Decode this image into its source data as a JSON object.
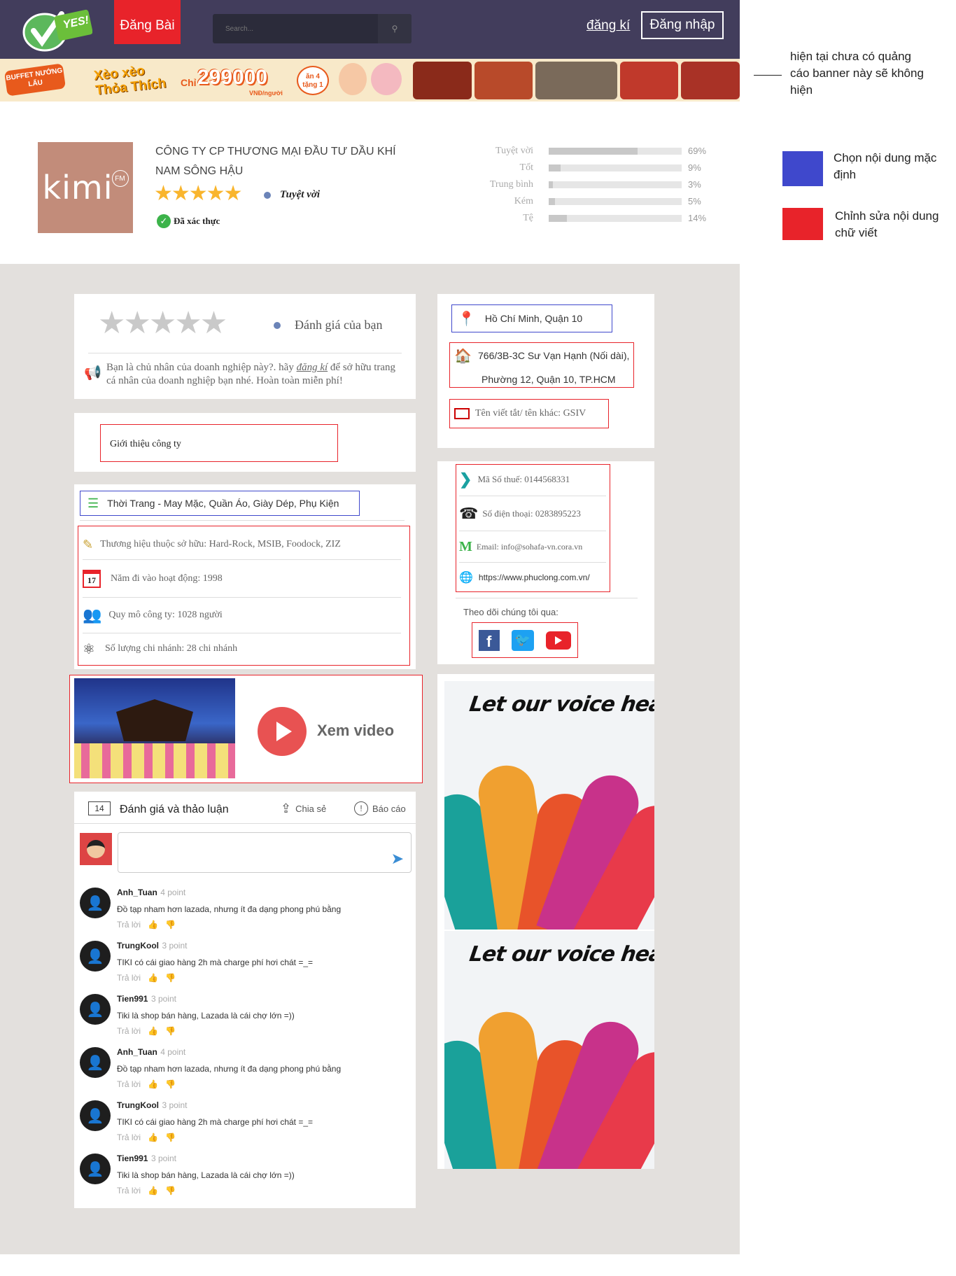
{
  "header": {
    "logo_text": "YES!",
    "post_button": "Đăng Bài",
    "search_placeholder": "Search...",
    "register_link": "đăng kí",
    "login_button": "Đăng nhập"
  },
  "banner": {
    "tag": "BUFFET NƯỚNG LẨU",
    "slogan": "Xèo xèo Thỏa Thích",
    "price_prefix": "Chỉ",
    "price": "299000",
    "unit": "VNĐ/người",
    "promo": "ăn 4 tặng 1"
  },
  "annotations": {
    "banner_note": "hiện tại chưa có quảng cáo banner này sẽ không hiện",
    "blue_legend": "Chọn nội dung mặc định",
    "red_legend": "Chỉnh sửa nội dung chữ viết",
    "blue_color": "#3f48cc",
    "red_color": "#e8232a"
  },
  "company": {
    "logo_text": "kimi",
    "logo_sub": "FM",
    "name_line1": "CÔNG TY CP THƯƠNG MẠI ĐẦU TƯ DẦU KHÍ",
    "name_line2": "NAM SÔNG HẬU",
    "rating_label": "Tuyệt vời",
    "rating_stars": 5,
    "verified": "Đã xác thực"
  },
  "rating_breakdown": [
    {
      "label": "Tuyệt vời",
      "pct": "69%",
      "value": 0.69
    },
    {
      "label": "Tốt",
      "pct": "9%",
      "value": 0.09
    },
    {
      "label": "Trung bình",
      "pct": "3%",
      "value": 0.03
    },
    {
      "label": "Kém",
      "pct": "5%",
      "value": 0.05
    },
    {
      "label": "Tệ",
      "pct": "14%",
      "value": 0.14
    }
  ],
  "your_rating": {
    "label": "Đánh giá của bạn",
    "claim_text_before": "Bạn là chủ nhân của doanh nghiệp này?. hãy",
    "claim_link": "đăng kí",
    "claim_text_after": "để sở hữu trang cá nhân của doanh nghiệp bạn nhé. Hoàn toàn miễn phí!"
  },
  "intro": {
    "label": "Giới thiệu công ty"
  },
  "info": {
    "category": "Thời Trang - May Mặc, Quần Áo, Giày Dép, Phụ Kiện",
    "brands": "Thương hiệu thuộc sở hữu: Hard-Rock, MSIB, Foodock, ZIZ",
    "founded": "Năm đi vào hoạt động: 1998",
    "size": "Quy mô công ty: 1028 người",
    "branches": "Số lượng chi nhánh: 28 chi nhánh",
    "calendar_day": "17"
  },
  "video": {
    "label": "Xem video"
  },
  "location": {
    "city": "Hồ Chí Minh, Quận 10",
    "address_line1": "766/3B-3C Sư Vạn Hạnh (Nối dài),",
    "address_line2": "Phường 12, Quận 10, TP.HCM",
    "alias": "Tên viết tắt/ tên khác:  GSIV"
  },
  "contact": {
    "tax": "Mã Số thuế: 0144568331",
    "phone": "Số điện thoại: 0283895223",
    "email": "Email: info@sohafa-vn.cora.vn",
    "website": "https://www.phuclong.com.vn/",
    "follow": "Theo dõi chúng tôi qua:"
  },
  "ads": {
    "headline": "Let our voice heard!"
  },
  "discussion": {
    "count": "14",
    "title": "Đánh giá và thảo luận",
    "share": "Chia sẻ",
    "report": "Báo cáo",
    "reply": "Trả lời",
    "comments": [
      {
        "name": "Anh_Tuan",
        "points": "4 point",
        "text": "Đồ tạp nham hơn lazada, nhưng ít đa dạng phong phú bằng"
      },
      {
        "name": "TrungKool",
        "points": "3 point",
        "text": "TIKI có cái giao hàng 2h mà charge phí hơi chát =_="
      },
      {
        "name": "Tien991",
        "points": "3 point",
        "text": "Tiki là shop bán hàng, Lazada là cái chợ lớn =))"
      },
      {
        "name": "Anh_Tuan",
        "points": "4 point",
        "text": "Đồ tạp nham hơn lazada, nhưng ít đa dạng phong phú bằng"
      },
      {
        "name": "TrungKool",
        "points": "3 point",
        "text": "TIKI có cái giao hàng 2h mà charge phí hơi chát =_="
      },
      {
        "name": "Tien991",
        "points": "3 point",
        "text": "Tiki là shop bán hàng, Lazada là cái chợ lớn =))"
      }
    ]
  }
}
